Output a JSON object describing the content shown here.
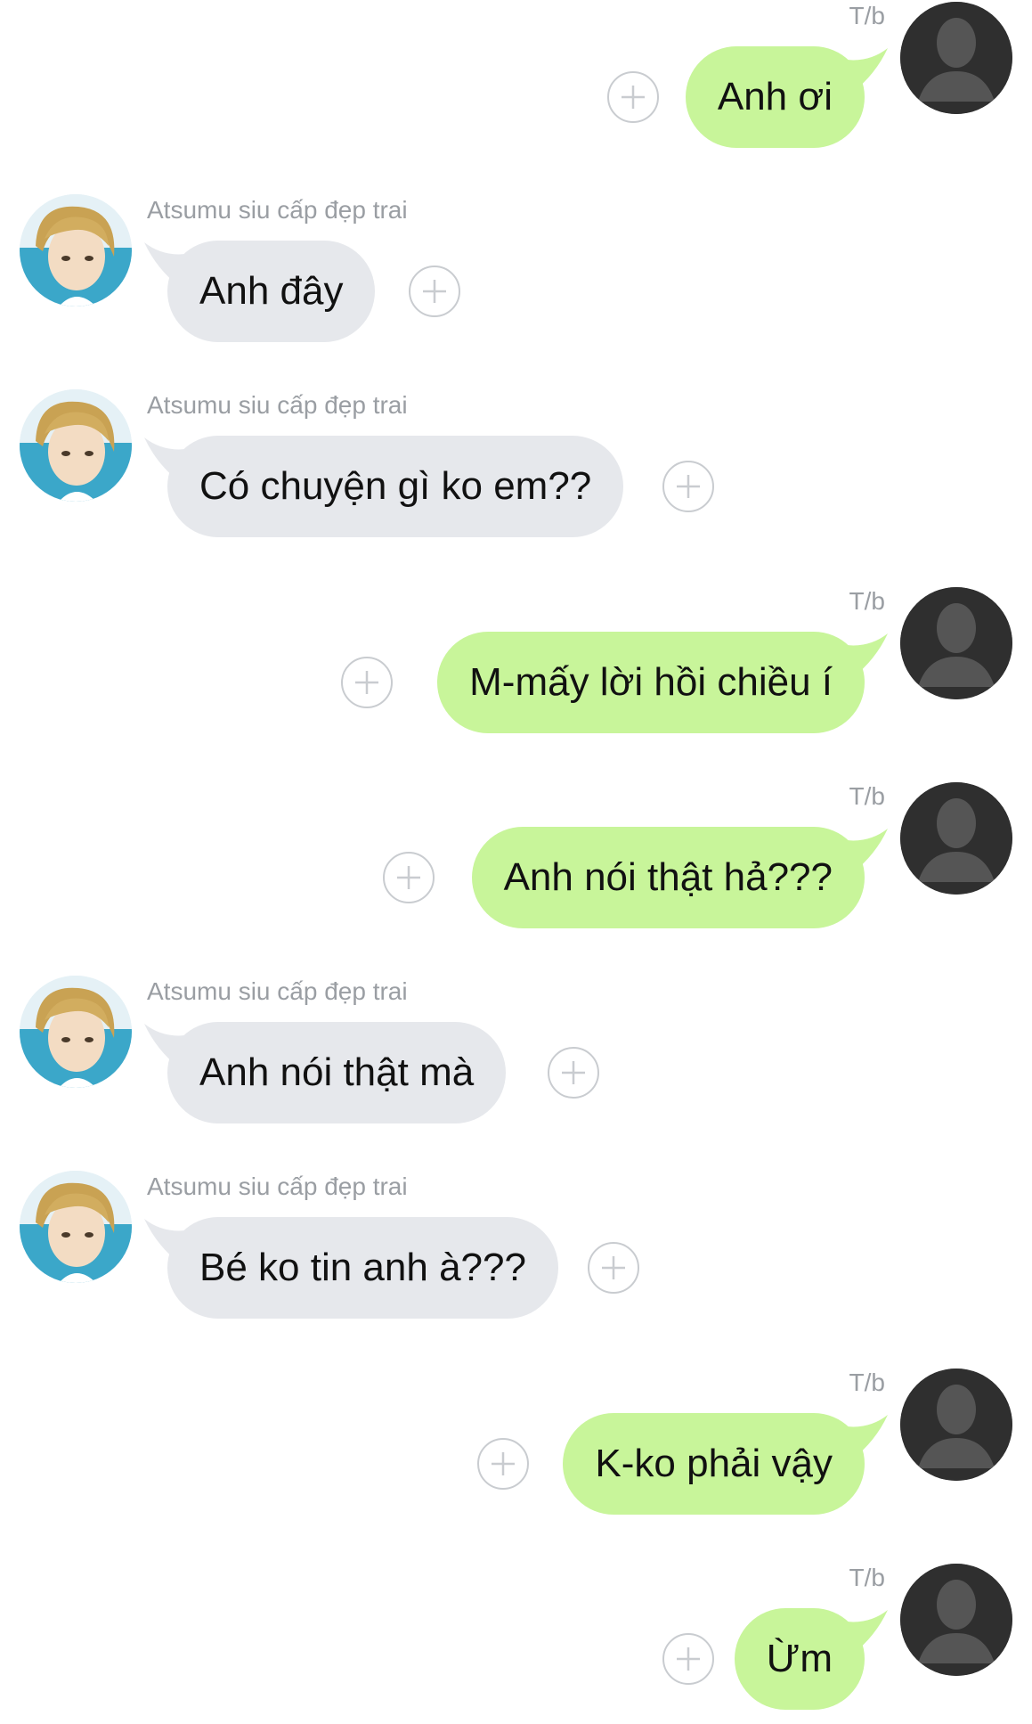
{
  "chat": {
    "me_name": "T/b",
    "other_name": "Atsumu siu cấp đẹp trai",
    "messages": [
      {
        "from": "me",
        "text": "Anh ơi"
      },
      {
        "from": "other",
        "text": "Anh đây"
      },
      {
        "from": "other",
        "text": "Có chuyện gì ko em??"
      },
      {
        "from": "me",
        "text": "M-mấy lời hồi chiều í"
      },
      {
        "from": "me",
        "text": "Anh nói thật hả???"
      },
      {
        "from": "other",
        "text": "Anh nói thật mà"
      },
      {
        "from": "other",
        "text": "Bé ko tin anh à???"
      },
      {
        "from": "me",
        "text": "K-ko phải vậy"
      },
      {
        "from": "me",
        "text": "Ừm"
      }
    ]
  },
  "icons": {
    "me_avatar": "person-silhouette-icon",
    "other_avatar": "anime-avatar-icon",
    "reaction_button": "plus-icon"
  },
  "colors": {
    "outgoing_bubble": "#c8f59a",
    "incoming_bubble": "#e6e8ec",
    "name_text": "#9a9ea3",
    "me_avatar_bg": "#2f2f2f"
  }
}
